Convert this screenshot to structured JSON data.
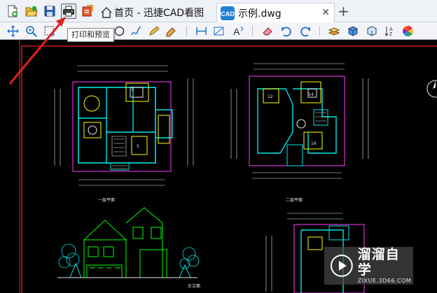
{
  "tabs": {
    "home_label": "首页 - 迅捷CAD看图",
    "doc_label": "示例.dwg",
    "close_glyph": "✕",
    "new_tab_glyph": "+"
  },
  "tooltip": {
    "text": "打印和预览"
  },
  "drawing": {
    "label_first_floor": "一层平面",
    "label_second_floor": "二层平面",
    "label_elevation": "正立面"
  },
  "watermark": {
    "title": "溜溜自学",
    "subtitle": "ZIXUE.3D66.COM"
  },
  "colors": {
    "cad_cyan": "#00e5e5",
    "cad_magenta": "#ff3cff",
    "cad_yellow": "#ffff00",
    "cad_green": "#00ff00",
    "cad_red": "#ff2020",
    "arrow_red": "#e0201c"
  },
  "icons": [
    "new-file-icon",
    "open-folder-icon",
    "save-icon",
    "print-icon",
    "export-pdf-icon",
    "home-icon",
    "cad-doc-icon",
    "pan-icon",
    "zoom-icon",
    "zoom-window-icon",
    "circle-icon",
    "polyline-icon",
    "pencil-icon",
    "eraser-icon",
    "undo-icon",
    "redo-icon",
    "layers-icon",
    "cube-icon",
    "3d-view-icon",
    "sort-icon",
    "color-wheel-icon"
  ]
}
